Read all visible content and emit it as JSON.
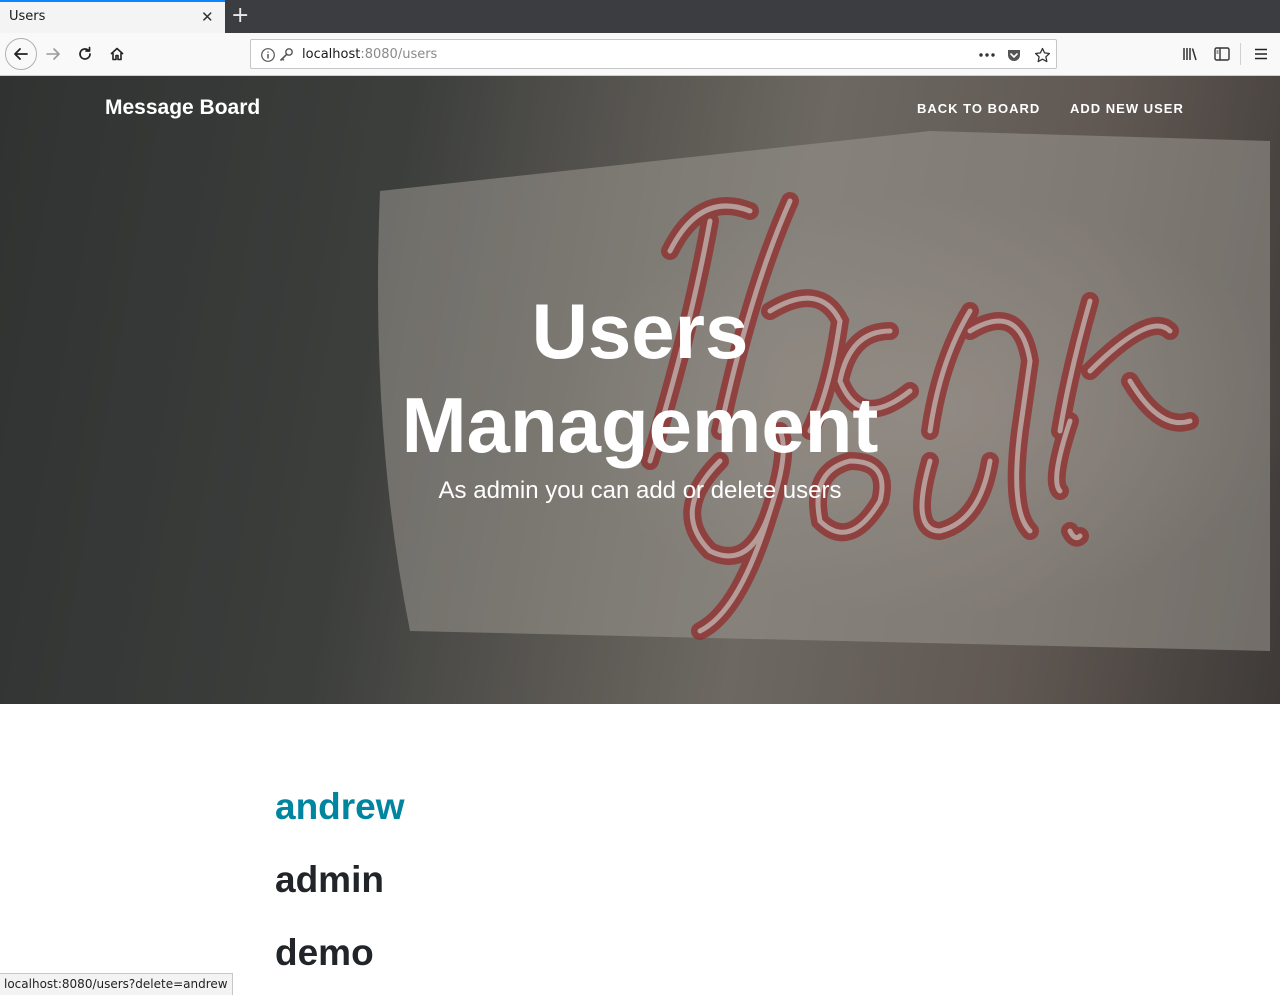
{
  "browser": {
    "tab_title": "Users",
    "url_host": "localhost",
    "url_rest": ":8080/users",
    "status_url": "localhost:8080/users?delete=andrew"
  },
  "site": {
    "brand": "Message Board",
    "nav": [
      "BACK TO BOARD",
      "ADD NEW USER"
    ]
  },
  "hero": {
    "title_line1": "Users",
    "title_line2": "Management",
    "subtitle": "As admin you can add or delete users"
  },
  "users": [
    "andrew",
    "admin",
    "demo"
  ],
  "colors": {
    "accent": "#0085a1",
    "text": "#212529"
  }
}
